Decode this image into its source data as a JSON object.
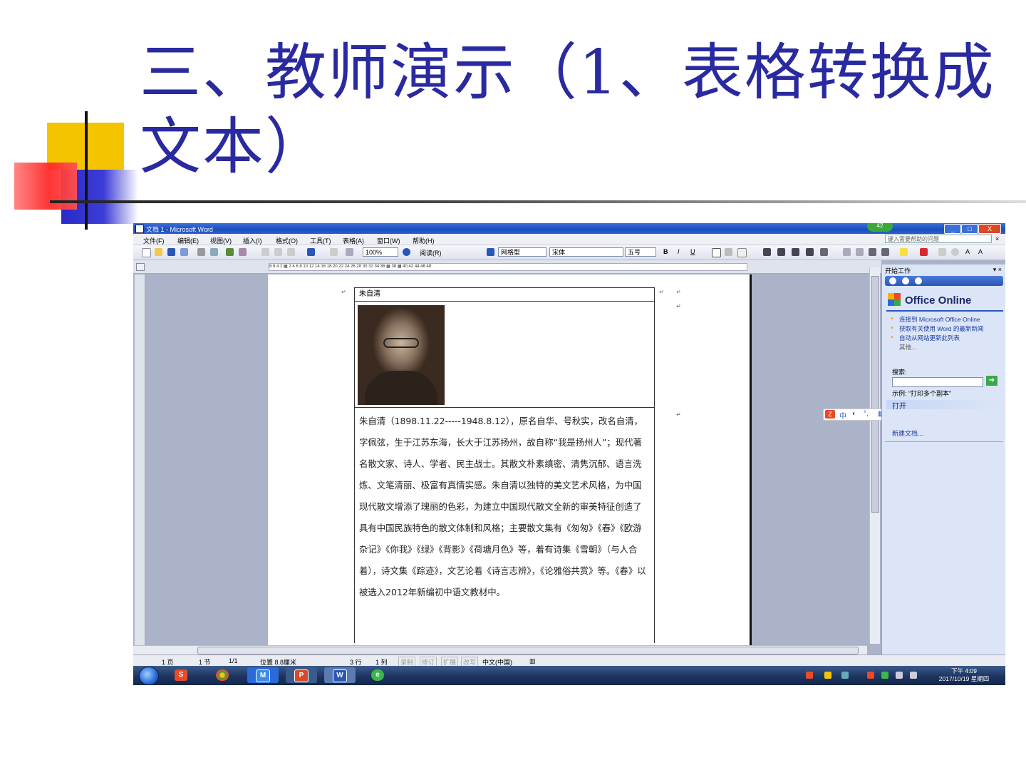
{
  "slide": {
    "title": "三、教师演示（1、表格转换成文本）"
  },
  "window": {
    "title": "文档 1 - Microsoft Word",
    "badge": "42",
    "minimize": "_",
    "maximize": "□",
    "close": "X"
  },
  "menu": {
    "items": [
      "文件(F)",
      "编辑(E)",
      "视图(V)",
      "插入(I)",
      "格式(O)",
      "工具(T)",
      "表格(A)",
      "窗口(W)",
      "帮助(H)"
    ],
    "help_placeholder": "键入需要帮助的问题",
    "close": "×"
  },
  "toolbar": {
    "zoom": "100%",
    "read_button": "阅读(R)",
    "style": "网格型",
    "font": "宋体",
    "size": "五号"
  },
  "ruler": {
    "ticks": "8   6   4   2   ▦   2   4   6   8   10   12   14   16   18   20   22   24   26   28   30   32   34   36 ▦ 38 ▦ 40   42   44   46   48"
  },
  "document": {
    "table_name": "朱自清",
    "biography": "朱自清（1898.11.22-----1948.8.12），原名自华、号秋实，改名自清，字佩弦，生于江苏东海，长大于江苏扬州，故自称“我是扬州人”；现代著名散文家、诗人、学者、民主战士。其散文朴素缜密、清隽沉郁、语言洗炼、文笔清丽、极富有真情实感。朱自清以独特的美文艺术风格，为中国现代散文增添了瑰丽的色彩，为建立中国现代散文全新的审美特征创造了具有中国民族特色的散文体制和风格；主要散文集有《匆匆》《春》《欧游杂记》《你我》《绿》《背影》《荷塘月色》等，着有诗集《雪朝》（与人合着），诗文集《踪迹》，文艺论着《诗言志辨》，《论雅俗共赏》等。《春》以被选入2012年新编初中语文教材中。"
  },
  "taskpane": {
    "title": "开始工作",
    "brand": "Office Online",
    "links": [
      "连接到 Microsoft Office Online",
      "获取有关使用 Word 的最新新闻",
      "自动从网站更新此列表"
    ],
    "more": "其他...",
    "search_label": "搜索:",
    "example": "示例: “打印多个副本”",
    "open_header": "打开",
    "new_doc": "新建文档..."
  },
  "ime": {
    "label": "中"
  },
  "status": {
    "page": "1 页",
    "section": "1 节",
    "pages": "1/1",
    "position": "位置 8.8厘米",
    "line": "3 行",
    "column": "1 列",
    "rec": "录制",
    "trk": "修订",
    "ext": "扩展",
    "ovr": "改写",
    "lang": "中文(中国)"
  },
  "clock": {
    "time": "下午 4:09",
    "date": "2017/10/19 星期四"
  },
  "colors": {
    "title": "#2a2aa0",
    "word_blue": "#1c4fc0",
    "taskbar": "#1c3460"
  }
}
